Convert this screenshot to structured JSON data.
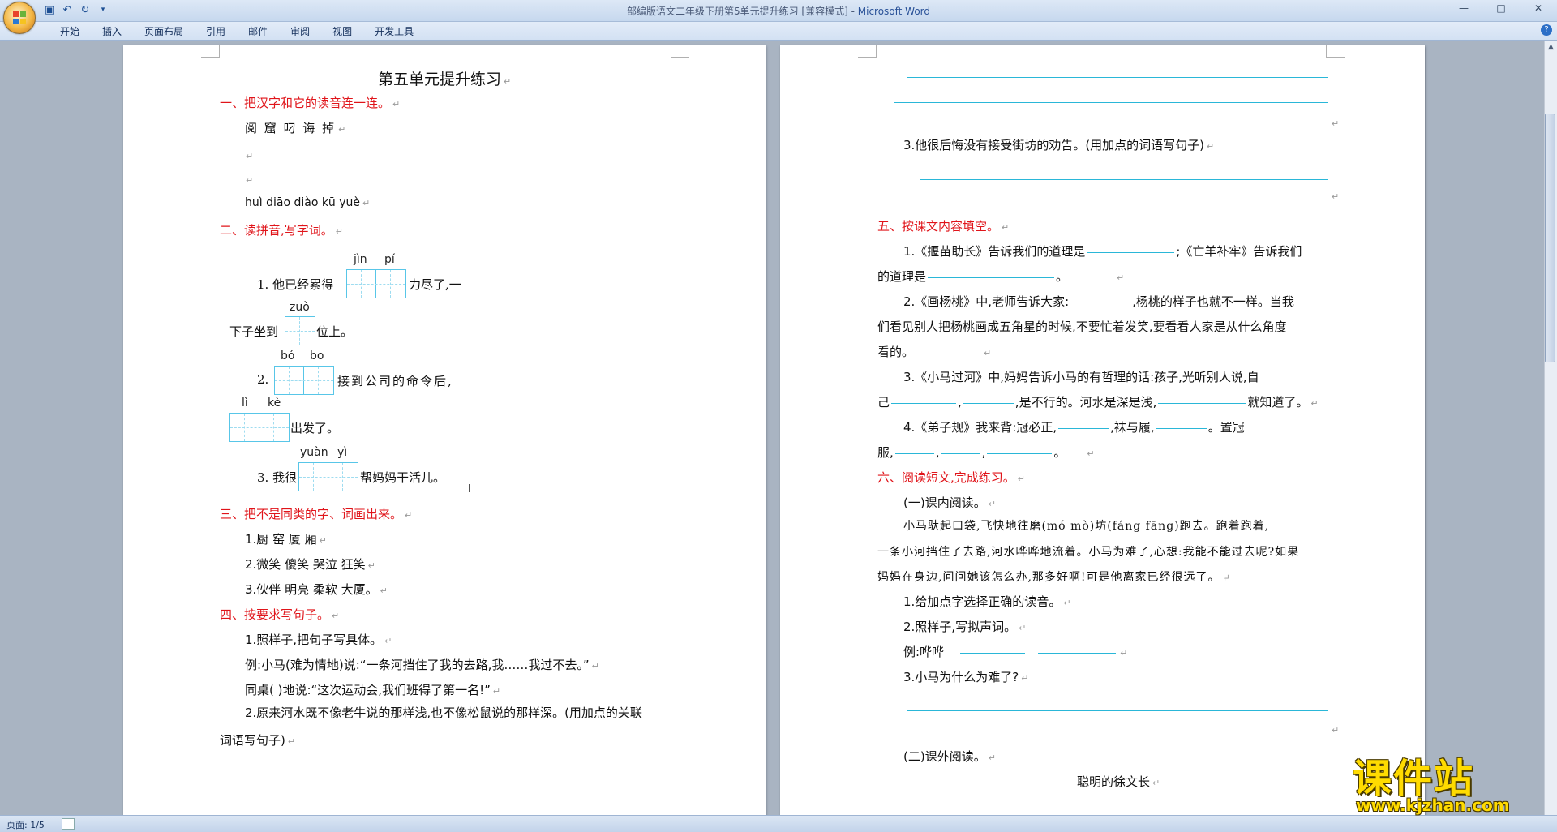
{
  "window": {
    "title_doc": "部编版语文二年级下册第5单元提升练习 [兼容模式] - ",
    "title_app": "Microsoft Word",
    "controls": [
      "—",
      "□",
      "✕"
    ]
  },
  "qat": {
    "icons": [
      "save-icon",
      "undo-icon",
      "redo-icon",
      "customize-icon"
    ]
  },
  "ribbon": {
    "tabs": [
      "开始",
      "插入",
      "页面布局",
      "引用",
      "邮件",
      "审阅",
      "视图",
      "开发工具"
    ]
  },
  "status": {
    "page": "页面: 1/5"
  },
  "page1": {
    "title": "第五单元提升练习",
    "s1": {
      "heading": "一、把汉字和它的读音连一连。",
      "chars": "阅  窟  叼  诲  掉",
      "pinyin": "huì   diāo   diào    kū   yuè"
    },
    "s2": {
      "heading": "二、读拼音,写字词。",
      "q1_py1": "jìn",
      "q1_py2": "pí",
      "q1_pre": "1. 他已经累得",
      "q1_post": "力尽了,一",
      "q1_py3": "zuò",
      "q1_line2_pre": "下子坐到",
      "q1_line2_post": "位上。",
      "q2_py1": "bó",
      "q2_py2": "bo",
      "q2_pre": "2.",
      "q2_post": "接到公司的命令后,",
      "q2_py3": "lì",
      "q2_py4": "kè",
      "q2_line2_post": "出发了。",
      "q3_py1": "yuàn",
      "q3_py2": "yì",
      "q3_pre": "3. 我很",
      "q3_post": "帮妈妈干活儿。"
    },
    "s3": {
      "heading": "三、把不是同类的字、词画出来。",
      "items": [
        "1.厨  窑  厦  厢",
        "2.微笑  傻笑  哭泣  狂笑",
        "3.伙伴  明亮  柔软  大厦。"
      ]
    },
    "s4": {
      "heading": "四、按要求写句子。",
      "q1": "1.照样子,把句子写具体。",
      "example": "例:小马(难为情地)说:“一条河挡住了我的去路,我……我过不去。”",
      "q1b": "同桌(        )地说:“这次运动会,我们班得了第一名!”",
      "q2": "2.原来河水既不像老牛说的那样浅,也不像松鼠说的那样深。(用加点的关联",
      "q2b": "词语写句子)"
    }
  },
  "page2": {
    "q3": "3.他很后悔没有接受街坊的劝告。(用加点的词语写句子)",
    "s5": {
      "heading": "五、按课文内容填空。",
      "l1a": "1.《揠苗助长》告诉我们的道理是",
      "l1b": ";《亡羊补牢》告诉我们",
      "l1c": "的道理是",
      "l2a": "2.《画杨桃》中,老师告诉大家:",
      "l2b": ",杨桃的样子也就不一样。当我",
      "l2c": "们看见别人把杨桃画成五角星的时候,不要忙着发笑,要看看人家是从什么角度",
      "l2d": "看的。",
      "l3a": "3.《小马过河》中,妈妈告诉小马的有哲理的话:孩子,光听别人说,自",
      "l3b": "己",
      "l3c": "是不行的。河水是深是浅,",
      "l3d": "就知道了。",
      "l4a": "4.《弟子规》我来背:冠必正,",
      "l4b": ",袜与履,",
      "l4c": "。置冠",
      "l4d": "服,"
    },
    "s6": {
      "heading": "六、阅读短文,完成练习。",
      "sub1": "(一)课内阅读。",
      "p1": "小马驮起口袋,飞快地往磨(mó  mò)坊(fáng  fāng)跑去。跑着跑着,",
      "p2": "一条小河挡住了去路,河水哗哗地流着。小马为难了,心想:我能不能过去呢?如果",
      "p3": "妈妈在身边,问问她该怎么办,那多好啊!可是他离家已经很远了。",
      "q1": "1.给加点字选择正确的读音。",
      "q2": "2.照样子,写拟声词。",
      "q2ex": "例:哗哗",
      "q3": "3.小马为什么为难了?",
      "sub2": "(二)课外阅读。",
      "story_title": "聪明的徐文长"
    }
  },
  "watermark": {
    "name": "课件站",
    "url": "www.kjzhan.com"
  }
}
